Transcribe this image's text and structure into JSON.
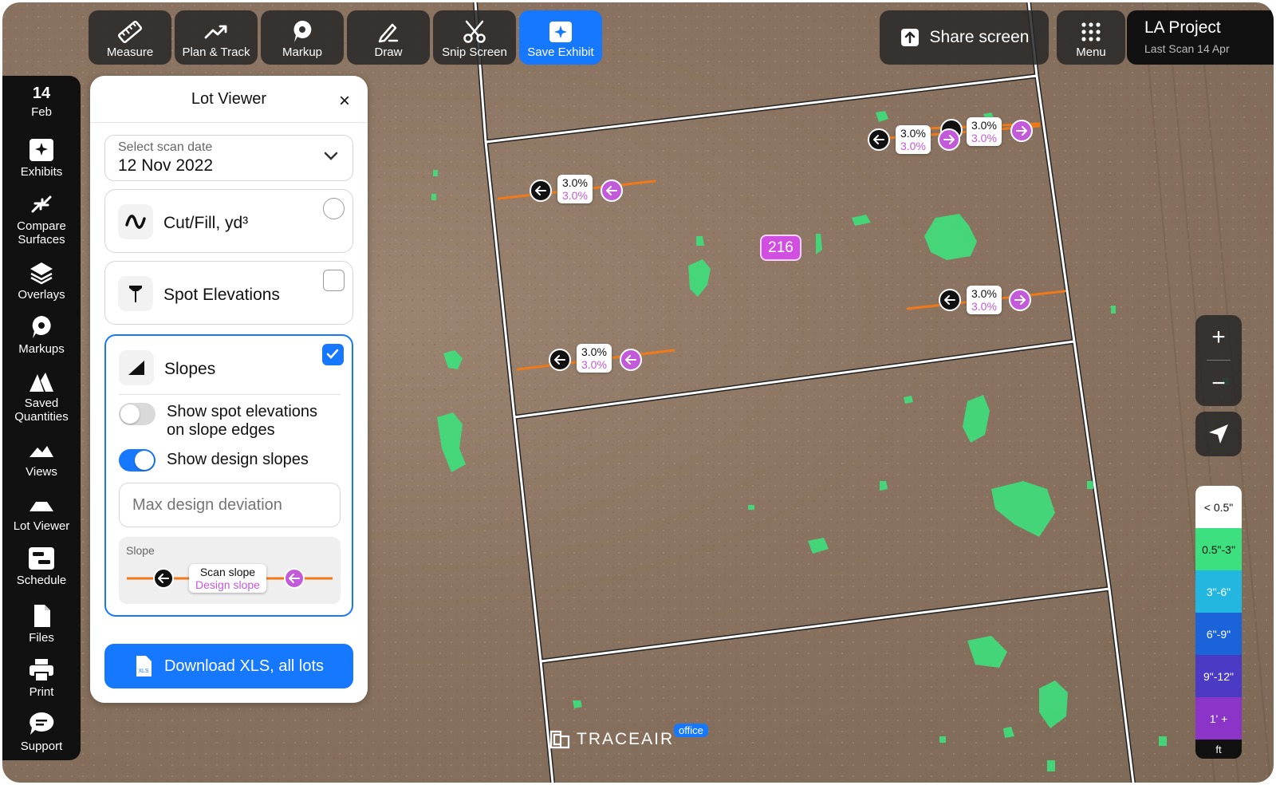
{
  "toolbar": {
    "measure": "Measure",
    "plan_track": "Plan & Track",
    "markup": "Markup",
    "draw": "Draw",
    "snip": "Snip Screen",
    "save_exhibit": "Save Exhibit"
  },
  "share": {
    "label": "Share screen"
  },
  "menu": {
    "label": "Menu"
  },
  "project": {
    "title": "LA Project",
    "subtitle": "Last Scan 14 Apr"
  },
  "sidebar": {
    "date_day": "14",
    "date_month": "Feb",
    "items": [
      {
        "label": "Exhibits"
      },
      {
        "label": "Compare\nSurfaces"
      },
      {
        "label": "Overlays"
      },
      {
        "label": "Markups"
      },
      {
        "label": "Saved\nQuantities"
      },
      {
        "label": "Views"
      },
      {
        "label": "Lot Viewer"
      },
      {
        "label": "Schedule"
      },
      {
        "label": "Files"
      },
      {
        "label": "Print"
      },
      {
        "label": "Support"
      }
    ]
  },
  "lot_viewer": {
    "title": "Lot Viewer",
    "close": "×",
    "scan_date_label": "Select scan date",
    "scan_date_value": "12 Nov 2022",
    "cut_fill": "Cut/Fill, yd³",
    "spot_elevations": "Spot Elevations",
    "slopes": "Slopes",
    "show_spot_line1": "Show spot elevations",
    "show_spot_line2": "on slope edges",
    "show_design": "Show design slopes",
    "max_dev_placeholder": "Max design deviation",
    "legend_title": "Slope",
    "legend_scan": "Scan slope",
    "legend_design": "Design slope",
    "download": "Download XLS, all lots",
    "xls_icon_text": "XLS"
  },
  "map": {
    "lot_number": "216",
    "slope_labels": [
      {
        "scan": "3.0%",
        "design": "3.0%"
      },
      {
        "scan": "3.0%",
        "design": "3.0%"
      },
      {
        "scan": "3.0%",
        "design": "3.0%"
      },
      {
        "scan": "3.0%",
        "design": "3.0%"
      },
      {
        "scan": "3.0%",
        "design": "3.0%"
      }
    ]
  },
  "zoom": {
    "in": "+",
    "out": "−"
  },
  "scale": {
    "segments": [
      {
        "label": "< 0.5\"",
        "color": "#ffffff",
        "text": "#111111"
      },
      {
        "label": "0.5\"-3\"",
        "color": "#3de07e",
        "text": "#111111"
      },
      {
        "label": "3\"-6\"",
        "color": "#23b6e0",
        "text": "#ffffff"
      },
      {
        "label": "6\"-9\"",
        "color": "#1a63d8",
        "text": "#ffffff"
      },
      {
        "label": "9\"-12\"",
        "color": "#4b3bc4",
        "text": "#ffffff"
      },
      {
        "label": "1' +",
        "color": "#8a34c8",
        "text": "#ffffff"
      }
    ],
    "unit": "ft"
  },
  "brand": {
    "name": "TRACEAIR",
    "badge": "office"
  },
  "colors": {
    "accent": "#1677ff",
    "slope_line": "#f07a1a",
    "design_arrow": "#c35ad9",
    "fill_area": "#3ee07c"
  }
}
